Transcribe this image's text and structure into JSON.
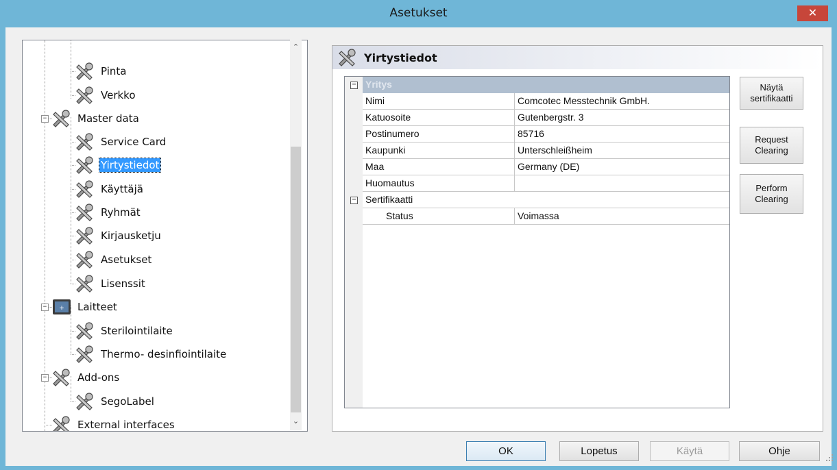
{
  "window": {
    "title": "Asetukset",
    "close_icon": "close-icon"
  },
  "tree": {
    "items": [
      {
        "label": "Pinta",
        "icon": "tools-icon"
      },
      {
        "label": "Verkko",
        "icon": "tools-icon"
      },
      {
        "label": "Master data",
        "icon": "tools-icon"
      },
      {
        "label": "Service Card",
        "icon": "tools-icon"
      },
      {
        "label": "Yirtystiedot",
        "icon": "tools-icon",
        "selected": true
      },
      {
        "label": "Käyttäjä",
        "icon": "tools-icon"
      },
      {
        "label": "Ryhmät",
        "icon": "tools-icon"
      },
      {
        "label": "Kirjausketju",
        "icon": "tools-icon"
      },
      {
        "label": "Asetukset",
        "icon": "tools-icon"
      },
      {
        "label": "Lisenssit",
        "icon": "tools-icon"
      },
      {
        "label": "Laitteet",
        "icon": "device-icon"
      },
      {
        "label": "Sterilointilaite",
        "icon": "tools-icon"
      },
      {
        "label": "Thermo- desinfiointilaite",
        "icon": "tools-icon"
      },
      {
        "label": "Add-ons",
        "icon": "tools-icon"
      },
      {
        "label": "SegoLabel",
        "icon": "tools-icon"
      },
      {
        "label": "External interfaces",
        "icon": "tools-icon"
      }
    ]
  },
  "panel": {
    "title": "Yirtystiedot",
    "grid": {
      "category": "Yritys",
      "rows": [
        {
          "name": "Nimi",
          "value": "Comcotec Messtechnik GmbH."
        },
        {
          "name": "Katuosoite",
          "value": "Gutenbergstr. 3"
        },
        {
          "name": "Postinumero",
          "value": "85716"
        },
        {
          "name": "Kaupunki",
          "value": "Unterschleißheim"
        },
        {
          "name": "Maa",
          "value": "Germany (DE)"
        },
        {
          "name": "Huomautus",
          "value": ""
        }
      ],
      "subcategory": "Sertifikaatti",
      "subrows": [
        {
          "name": "Status",
          "value": "Voimassa"
        }
      ]
    },
    "side_buttons": {
      "show_cert_line1": "Näytä",
      "show_cert_line2": "sertifikaatti",
      "request_line1": "Request",
      "request_line2": "Clearing",
      "perform_line1": "Perform",
      "perform_line2": "Clearing"
    }
  },
  "footer": {
    "ok": "OK",
    "cancel": "Lopetus",
    "apply": "Käytä",
    "help": "Ohje"
  }
}
